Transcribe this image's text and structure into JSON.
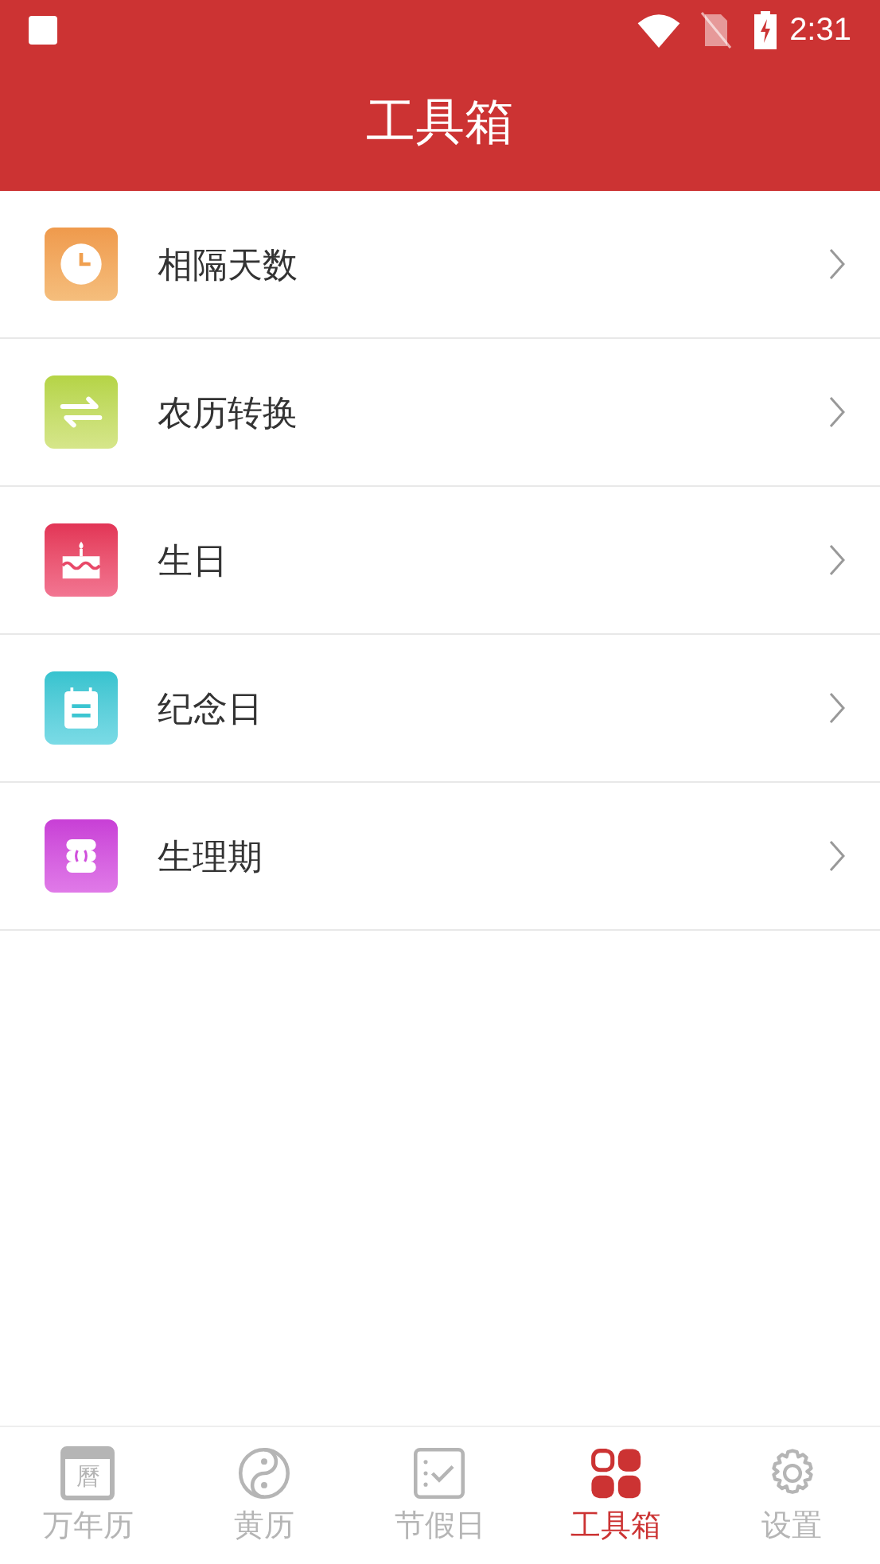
{
  "status_bar": {
    "time": "2:31"
  },
  "header": {
    "title": "工具箱"
  },
  "tools": [
    {
      "label": "相隔天数",
      "kind": "clock"
    },
    {
      "label": "农历转换",
      "kind": "swap"
    },
    {
      "label": "生日",
      "kind": "cake"
    },
    {
      "label": "纪念日",
      "kind": "note"
    },
    {
      "label": "生理期",
      "kind": "pad"
    }
  ],
  "tabs": [
    {
      "label": "万年历",
      "kind": "calendar",
      "glyph": "曆",
      "selected": false
    },
    {
      "label": "黄历",
      "kind": "yinyang",
      "selected": false
    },
    {
      "label": "节假日",
      "kind": "checklist",
      "selected": false
    },
    {
      "label": "工具箱",
      "kind": "grid",
      "selected": true
    },
    {
      "label": "设置",
      "kind": "gear",
      "selected": false
    }
  ]
}
